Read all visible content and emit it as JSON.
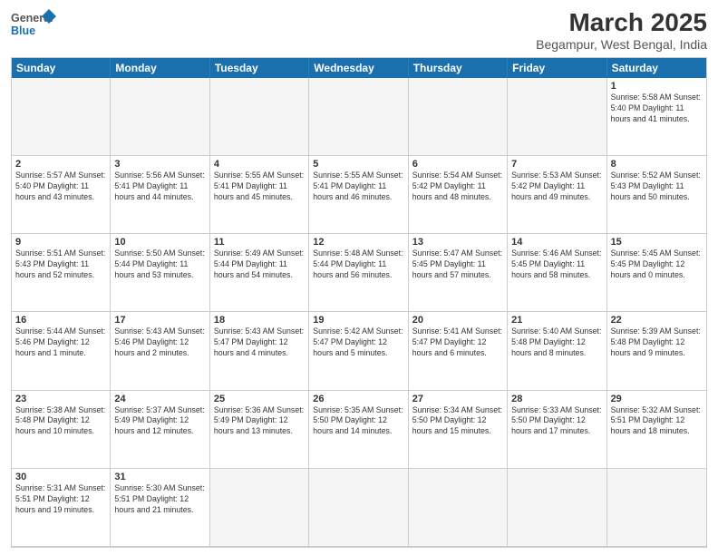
{
  "header": {
    "logo_general": "General",
    "logo_blue": "Blue",
    "main_title": "March 2025",
    "sub_title": "Begampur, West Bengal, India"
  },
  "weekdays": [
    "Sunday",
    "Monday",
    "Tuesday",
    "Wednesday",
    "Thursday",
    "Friday",
    "Saturday"
  ],
  "cells": [
    {
      "day": "",
      "empty": true,
      "info": ""
    },
    {
      "day": "",
      "empty": true,
      "info": ""
    },
    {
      "day": "",
      "empty": true,
      "info": ""
    },
    {
      "day": "",
      "empty": true,
      "info": ""
    },
    {
      "day": "",
      "empty": true,
      "info": ""
    },
    {
      "day": "",
      "empty": true,
      "info": ""
    },
    {
      "day": "1",
      "empty": false,
      "info": "Sunrise: 5:58 AM\nSunset: 5:40 PM\nDaylight: 11 hours\nand 41 minutes."
    },
    {
      "day": "2",
      "empty": false,
      "info": "Sunrise: 5:57 AM\nSunset: 5:40 PM\nDaylight: 11 hours\nand 43 minutes."
    },
    {
      "day": "3",
      "empty": false,
      "info": "Sunrise: 5:56 AM\nSunset: 5:41 PM\nDaylight: 11 hours\nand 44 minutes."
    },
    {
      "day": "4",
      "empty": false,
      "info": "Sunrise: 5:55 AM\nSunset: 5:41 PM\nDaylight: 11 hours\nand 45 minutes."
    },
    {
      "day": "5",
      "empty": false,
      "info": "Sunrise: 5:55 AM\nSunset: 5:41 PM\nDaylight: 11 hours\nand 46 minutes."
    },
    {
      "day": "6",
      "empty": false,
      "info": "Sunrise: 5:54 AM\nSunset: 5:42 PM\nDaylight: 11 hours\nand 48 minutes."
    },
    {
      "day": "7",
      "empty": false,
      "info": "Sunrise: 5:53 AM\nSunset: 5:42 PM\nDaylight: 11 hours\nand 49 minutes."
    },
    {
      "day": "8",
      "empty": false,
      "info": "Sunrise: 5:52 AM\nSunset: 5:43 PM\nDaylight: 11 hours\nand 50 minutes."
    },
    {
      "day": "9",
      "empty": false,
      "info": "Sunrise: 5:51 AM\nSunset: 5:43 PM\nDaylight: 11 hours\nand 52 minutes."
    },
    {
      "day": "10",
      "empty": false,
      "info": "Sunrise: 5:50 AM\nSunset: 5:44 PM\nDaylight: 11 hours\nand 53 minutes."
    },
    {
      "day": "11",
      "empty": false,
      "info": "Sunrise: 5:49 AM\nSunset: 5:44 PM\nDaylight: 11 hours\nand 54 minutes."
    },
    {
      "day": "12",
      "empty": false,
      "info": "Sunrise: 5:48 AM\nSunset: 5:44 PM\nDaylight: 11 hours\nand 56 minutes."
    },
    {
      "day": "13",
      "empty": false,
      "info": "Sunrise: 5:47 AM\nSunset: 5:45 PM\nDaylight: 11 hours\nand 57 minutes."
    },
    {
      "day": "14",
      "empty": false,
      "info": "Sunrise: 5:46 AM\nSunset: 5:45 PM\nDaylight: 11 hours\nand 58 minutes."
    },
    {
      "day": "15",
      "empty": false,
      "info": "Sunrise: 5:45 AM\nSunset: 5:45 PM\nDaylight: 12 hours\nand 0 minutes."
    },
    {
      "day": "16",
      "empty": false,
      "info": "Sunrise: 5:44 AM\nSunset: 5:46 PM\nDaylight: 12 hours\nand 1 minute."
    },
    {
      "day": "17",
      "empty": false,
      "info": "Sunrise: 5:43 AM\nSunset: 5:46 PM\nDaylight: 12 hours\nand 2 minutes."
    },
    {
      "day": "18",
      "empty": false,
      "info": "Sunrise: 5:43 AM\nSunset: 5:47 PM\nDaylight: 12 hours\nand 4 minutes."
    },
    {
      "day": "19",
      "empty": false,
      "info": "Sunrise: 5:42 AM\nSunset: 5:47 PM\nDaylight: 12 hours\nand 5 minutes."
    },
    {
      "day": "20",
      "empty": false,
      "info": "Sunrise: 5:41 AM\nSunset: 5:47 PM\nDaylight: 12 hours\nand 6 minutes."
    },
    {
      "day": "21",
      "empty": false,
      "info": "Sunrise: 5:40 AM\nSunset: 5:48 PM\nDaylight: 12 hours\nand 8 minutes."
    },
    {
      "day": "22",
      "empty": false,
      "info": "Sunrise: 5:39 AM\nSunset: 5:48 PM\nDaylight: 12 hours\nand 9 minutes."
    },
    {
      "day": "23",
      "empty": false,
      "info": "Sunrise: 5:38 AM\nSunset: 5:48 PM\nDaylight: 12 hours\nand 10 minutes."
    },
    {
      "day": "24",
      "empty": false,
      "info": "Sunrise: 5:37 AM\nSunset: 5:49 PM\nDaylight: 12 hours\nand 12 minutes."
    },
    {
      "day": "25",
      "empty": false,
      "info": "Sunrise: 5:36 AM\nSunset: 5:49 PM\nDaylight: 12 hours\nand 13 minutes."
    },
    {
      "day": "26",
      "empty": false,
      "info": "Sunrise: 5:35 AM\nSunset: 5:50 PM\nDaylight: 12 hours\nand 14 minutes."
    },
    {
      "day": "27",
      "empty": false,
      "info": "Sunrise: 5:34 AM\nSunset: 5:50 PM\nDaylight: 12 hours\nand 15 minutes."
    },
    {
      "day": "28",
      "empty": false,
      "info": "Sunrise: 5:33 AM\nSunset: 5:50 PM\nDaylight: 12 hours\nand 17 minutes."
    },
    {
      "day": "29",
      "empty": false,
      "info": "Sunrise: 5:32 AM\nSunset: 5:51 PM\nDaylight: 12 hours\nand 18 minutes."
    },
    {
      "day": "30",
      "empty": false,
      "info": "Sunrise: 5:31 AM\nSunset: 5:51 PM\nDaylight: 12 hours\nand 19 minutes."
    },
    {
      "day": "31",
      "empty": false,
      "info": "Sunrise: 5:30 AM\nSunset: 5:51 PM\nDaylight: 12 hours\nand 21 minutes."
    },
    {
      "day": "",
      "empty": true,
      "info": ""
    },
    {
      "day": "",
      "empty": true,
      "info": ""
    },
    {
      "day": "",
      "empty": true,
      "info": ""
    },
    {
      "day": "",
      "empty": true,
      "info": ""
    },
    {
      "day": "",
      "empty": true,
      "info": ""
    }
  ]
}
